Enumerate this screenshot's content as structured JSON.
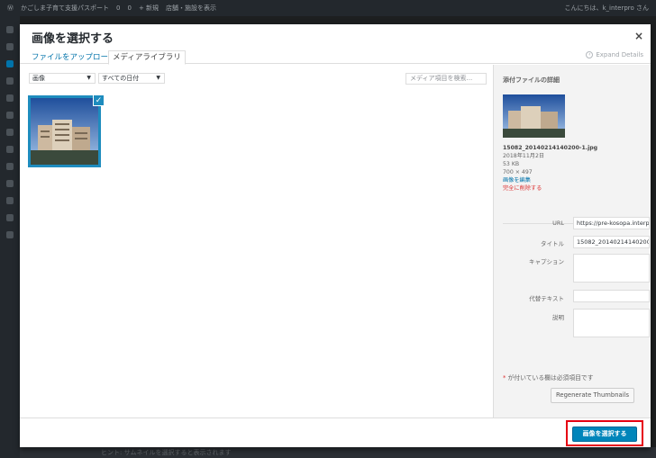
{
  "adminbar": {
    "site": "かごしま子育て支援パスポート",
    "comments": "0",
    "updates": "0",
    "new": "+ 新規",
    "show": "店舗・施設を表示",
    "greeting": "こんにちは、k_interpro さん"
  },
  "modal": {
    "title": "画像を選択する",
    "close": "×",
    "expand_details": "Expand Details"
  },
  "tabs": {
    "upload": "ファイルをアップロード",
    "library": "メディアライブラリ"
  },
  "filters": {
    "type": "画像",
    "date": "すべての日付",
    "search_placeholder": "メディア項目を検索..."
  },
  "attachment": {
    "details_title": "添付ファイルの詳細",
    "filename": "15082_20140214140200-1.jpg",
    "date": "2018年11月2日",
    "filesize": "53 KB",
    "dimensions": "700 × 497",
    "edit_link": "画像を編集",
    "delete_link": "完全に削除する"
  },
  "fields": {
    "url_label": "URL",
    "url_value": "https://pre-kosopa.interpro",
    "title_label": "タイトル",
    "title_value": "15082_20140214140200-1",
    "caption_label": "キャプション",
    "alt_label": "代替テキスト",
    "description_label": "説明"
  },
  "required_note": {
    "star": "*",
    "text": "が付いている欄は必須項目です"
  },
  "regenerate_button": "Regenerate Thumbnails",
  "select_button": "画像を選択する",
  "footer_hint": "ヒント: サムネイルを選択すると表示されます",
  "colors": {
    "accent": "#0085ba",
    "selection": "#1e8cbe",
    "danger": "#dc3232",
    "highlight": "#e60012"
  }
}
